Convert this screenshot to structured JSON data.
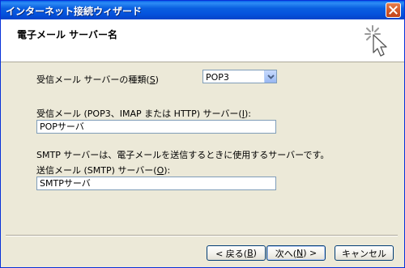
{
  "window": {
    "title": "インターネット接続ウィザード",
    "close_icon": "close-icon"
  },
  "header": {
    "title": "電子メール サーバー名",
    "icon": "wizard-sparkle-cursor-icon"
  },
  "form": {
    "server_type_label_prefix": "受信メール サーバーの種類(",
    "server_type_accel": "S",
    "server_type_label_suffix": ")",
    "server_type_value": "POP3",
    "incoming_label_prefix": "受信メール (POP3、IMAP または HTTP) サーバー(",
    "incoming_accel": "I",
    "incoming_label_suffix": "):",
    "incoming_value": "POPサーバ",
    "smtp_description": "SMTP サーバーは、電子メールを送信するときに使用するサーバーです。",
    "outgoing_label_prefix": "送信メール (SMTP) サーバー(",
    "outgoing_accel": "O",
    "outgoing_label_suffix": "):",
    "outgoing_value": "SMTPサーバ"
  },
  "buttons": {
    "back_prefix": "< 戻る(",
    "back_accel": "B",
    "back_suffix": ")",
    "next_prefix": "次へ(",
    "next_accel": "N",
    "next_suffix": ") >",
    "cancel": "キャンセル"
  },
  "colors": {
    "titlebar": "#0553DD",
    "dialog_bg": "#ECE9D8",
    "field_border": "#7F9DB9"
  }
}
